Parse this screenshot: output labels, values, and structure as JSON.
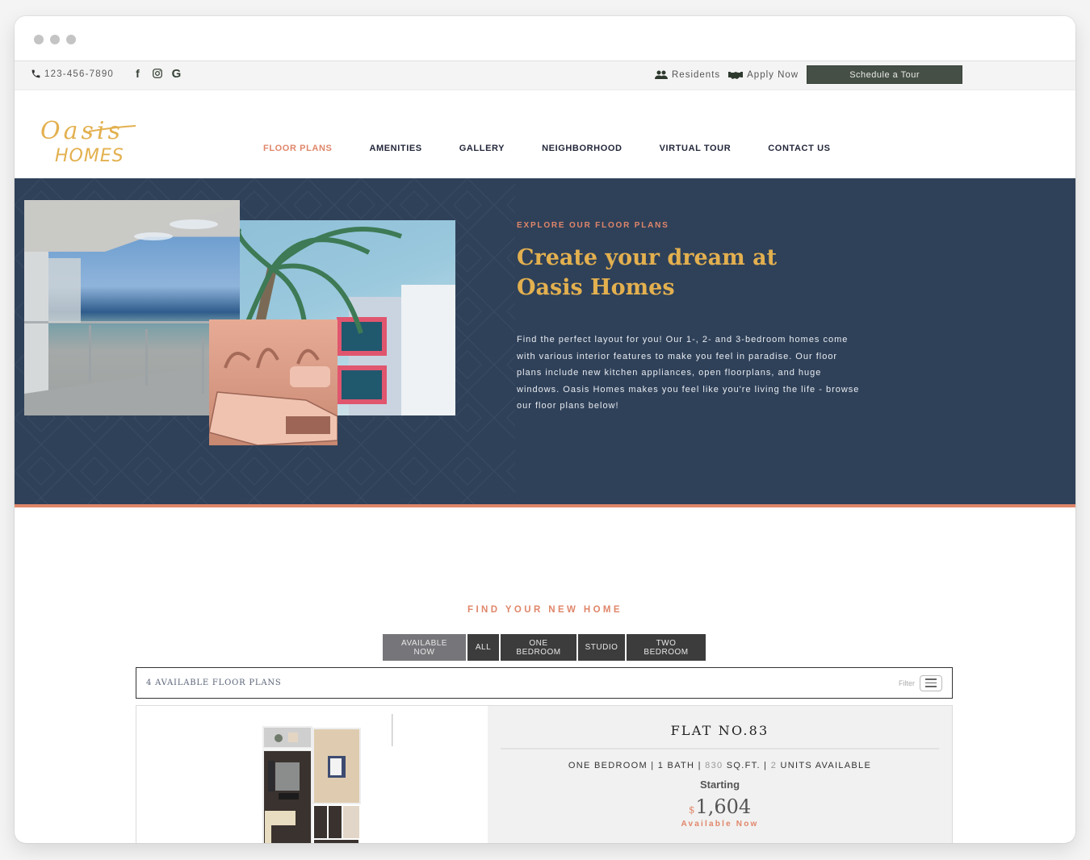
{
  "topbar": {
    "phone": "123-456-7890",
    "social": [
      {
        "name": "facebook-icon",
        "glyph": "f"
      },
      {
        "name": "instagram-icon",
        "glyph": "◎"
      },
      {
        "name": "google-icon",
        "glyph": "G"
      }
    ],
    "residents_label": "Residents",
    "apply_label": "Apply Now",
    "tour_label": "Schedule a Tour"
  },
  "header": {
    "logo_line1": "Oasis",
    "logo_line2": "HOMES",
    "nav": [
      {
        "label": "FLOOR PLANS",
        "active": true
      },
      {
        "label": "AMENITIES",
        "active": false
      },
      {
        "label": "GALLERY",
        "active": false
      },
      {
        "label": "NEIGHBORHOOD",
        "active": false
      },
      {
        "label": "VIRTUAL TOUR",
        "active": false
      },
      {
        "label": "CONTACT US",
        "active": false
      }
    ]
  },
  "hero": {
    "eyebrow": "EXPLORE OUR FLOOR PLANS",
    "title_line1": "Create your dream at",
    "title_line2": "Oasis Homes",
    "description": "Find the perfect layout for you! Our 1-, 2- and 3-bedroom homes come with various interior features to make you feel in paradise. Our floor plans include new kitchen appliances, open floorplans, and huge windows. Oasis Homes makes you feel like you're living the life - browse our floor plans below!",
    "images": [
      "balcony-ocean-view-photo",
      "palm-tree-building-photo",
      "vintage-car-photo"
    ]
  },
  "listing": {
    "section_title": "FIND YOUR NEW HOME",
    "tabs": [
      {
        "label": "AVAILABLE NOW",
        "active": true
      },
      {
        "label": "ALL",
        "active": false
      },
      {
        "label": "ONE BEDROOM",
        "active": false
      },
      {
        "label": "STUDIO",
        "active": false
      },
      {
        "label": "TWO BEDROOM",
        "active": false
      }
    ],
    "count_label": "4 AVAILABLE FLOOR PLANS",
    "filter_label": "Filter",
    "plans": [
      {
        "name": "FLAT NO.83",
        "bedrooms": "ONE BEDROOM",
        "baths": "1 BATH",
        "sqft": "830",
        "sqft_unit": "SQ.FT.",
        "units": "2",
        "units_label": "UNITS AVAILABLE",
        "starting_label": "Starting",
        "currency": "$",
        "price": "1,604",
        "status": "Available Now"
      }
    ]
  },
  "colors": {
    "accent": "#e0866a",
    "gold": "#e3b04f",
    "navy": "#2f4159",
    "dark_green": "#454f45"
  }
}
